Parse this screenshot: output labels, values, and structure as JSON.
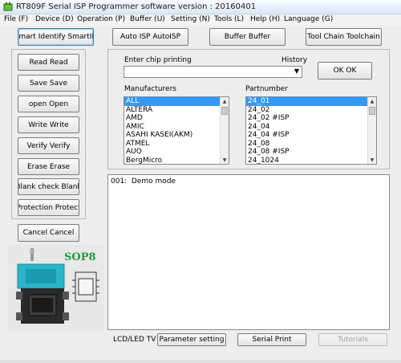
{
  "window": {
    "title": "RT809F Serial ISP Programmer software version : 20160401"
  },
  "menu": [
    {
      "label": "File (F)"
    },
    {
      "label": "Device (D)"
    },
    {
      "label": "Operation (P)"
    },
    {
      "label": "Buffer (U)"
    },
    {
      "label": "Setting (N)"
    },
    {
      "label": "Tools (L)"
    },
    {
      "label": "Help (H)"
    },
    {
      "label": "Language (G)"
    }
  ],
  "toolbar": {
    "smart_identify": "Smart Identify SmartID",
    "auto_isp": "Auto ISP AutoISP",
    "buffer": "Buffer Buffer",
    "tool_chain": "Tool Chain Toolchain"
  },
  "side_buttons": {
    "read": "Read Read",
    "save": "Save Save",
    "open": "open Open",
    "write": "Write Write",
    "verify": "Verify Verify",
    "erase": "Erase Erase",
    "blank_check": "Blank check Blank",
    "protection": "Protection Protect",
    "cancel": "Cancel Cancel"
  },
  "chip_image": {
    "package_label": "SOP8"
  },
  "chip_search": {
    "label": "Enter chip printing",
    "history_label": "History",
    "value": "",
    "ok_button": "OK OK"
  },
  "manufacturers": {
    "label": "Manufacturers",
    "items": [
      "ALL",
      "ALTERA",
      "AMD",
      "AMIC",
      "ASAHI KASEI(AKM)",
      "ATMEL",
      "AUO",
      "BergMicro"
    ],
    "selected_index": 0
  },
  "partnumber": {
    "label": "Partnumber",
    "items": [
      "24_01",
      "24_02",
      "24_02 #ISP",
      "24_04",
      "24_04 #ISP",
      "24_08",
      "24_08 #ISP",
      "24_1024"
    ],
    "selected_index": 0
  },
  "log": {
    "lines": [
      "001:  Demo mode"
    ]
  },
  "bottom": {
    "lcd_label": "LCD/LED TV tool",
    "parameter_setting": "Parameter setting",
    "serial_print": "Serial Print",
    "tutorials": "Tutorials"
  },
  "colors": {
    "selection": "#3399ff",
    "chip_socket": "#2bb5c9",
    "sop8_text": "#1f9a3a"
  }
}
